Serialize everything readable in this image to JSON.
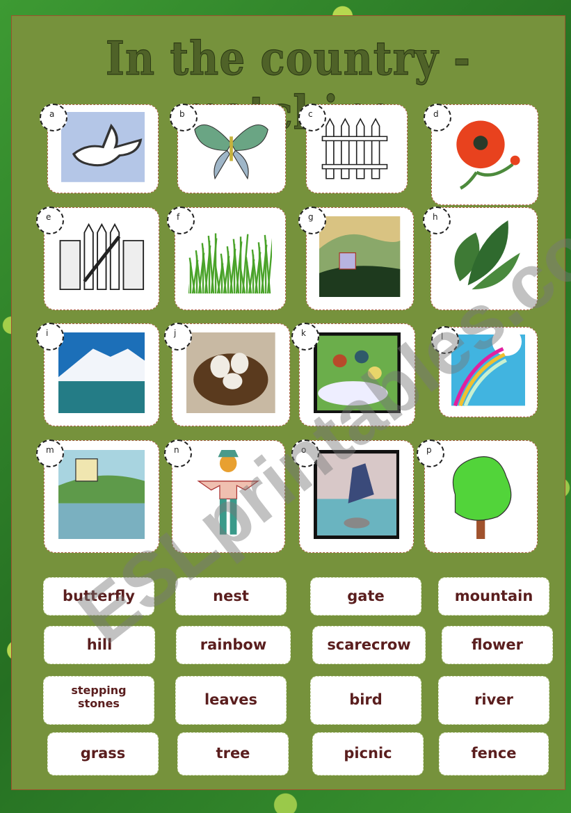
{
  "title": "In the country - matching",
  "watermark": "ESLprintables.com",
  "tiles": [
    {
      "letter": "a",
      "image": "bird"
    },
    {
      "letter": "b",
      "image": "butterfly"
    },
    {
      "letter": "c",
      "image": "fence"
    },
    {
      "letter": "d",
      "image": "flower"
    },
    {
      "letter": "e",
      "image": "gate"
    },
    {
      "letter": "f",
      "image": "grass"
    },
    {
      "letter": "g",
      "image": "hill"
    },
    {
      "letter": "h",
      "image": "leaves"
    },
    {
      "letter": "i",
      "image": "mountain"
    },
    {
      "letter": "j",
      "image": "nest"
    },
    {
      "letter": "k",
      "image": "picnic"
    },
    {
      "letter": "l",
      "image": "rainbow"
    },
    {
      "letter": "m",
      "image": "river"
    },
    {
      "letter": "n",
      "image": "scarecrow"
    },
    {
      "letter": "o",
      "image": "stepping-stones"
    },
    {
      "letter": "p",
      "image": "tree"
    }
  ],
  "words": [
    "butterfly",
    "nest",
    "gate",
    "mountain",
    "hill",
    "rainbow",
    "scarecrow",
    "flower",
    "stepping stones",
    "leaves",
    "bird",
    "river",
    "grass",
    "tree",
    "picnic",
    "fence"
  ],
  "colors": {
    "sheet": "#76923c",
    "title": "#4f6228",
    "word_text": "#5a1e1e"
  }
}
